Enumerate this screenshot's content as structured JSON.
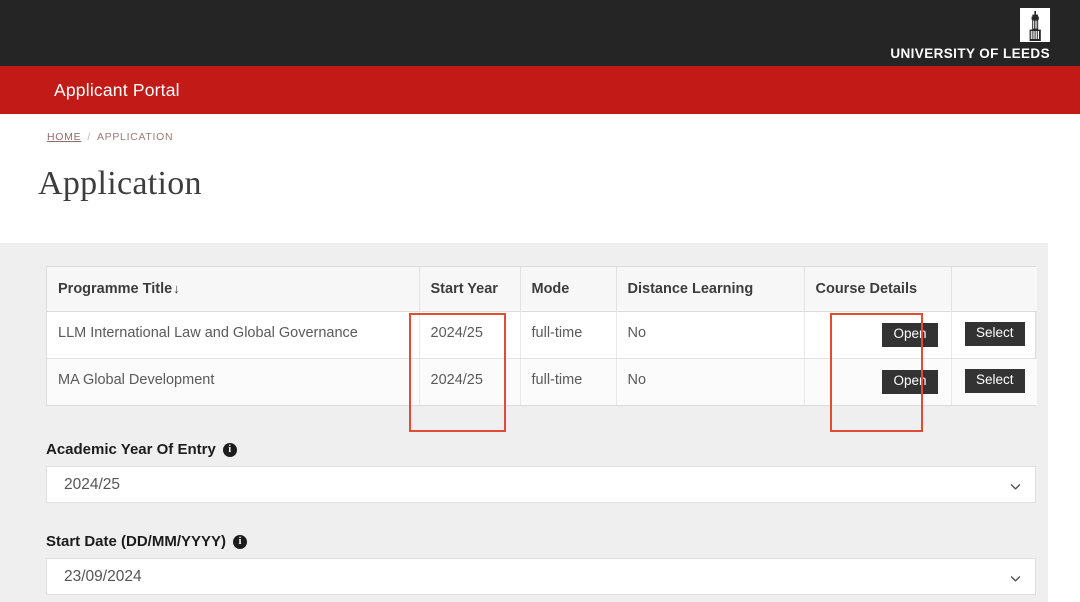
{
  "topbar": {
    "university_name": "UNIVERSITY OF LEEDS",
    "logo_icon": "parkinson-tower-icon"
  },
  "portalbar": {
    "title": "Applicant Portal",
    "background": "#c21b17"
  },
  "breadcrumb": {
    "home": "HOME",
    "separator": "/",
    "current": "APPLICATION"
  },
  "page": {
    "title": "Application"
  },
  "table": {
    "columns": [
      "Programme Title",
      "Start Year",
      "Mode",
      "Distance Learning",
      "Course Details",
      ""
    ],
    "sort_indicator": "↓",
    "rows": [
      {
        "programme_title": "LLM International Law and Global Governance",
        "start_year": "2024/25",
        "mode": "full-time",
        "distance_learning": "No",
        "course_details_label": "Open",
        "select_label": "Select"
      },
      {
        "programme_title": "MA Global Development",
        "start_year": "2024/25",
        "mode": "full-time",
        "distance_learning": "No",
        "course_details_label": "Open",
        "select_label": "Select"
      }
    ]
  },
  "annotations": {
    "color": "#e14c32",
    "boxes": [
      {
        "target": "start-year-column"
      },
      {
        "target": "course-details-column"
      }
    ]
  },
  "form": {
    "academic_year": {
      "label": "Academic Year Of Entry",
      "info_icon": "info-icon",
      "value": "2024/25",
      "chevron_icon": "chevron-down-icon"
    },
    "start_date": {
      "label": "Start Date (DD/MM/YYYY)",
      "info_icon": "info-icon",
      "value": "23/09/2024",
      "chevron_icon": "chevron-down-icon"
    }
  }
}
